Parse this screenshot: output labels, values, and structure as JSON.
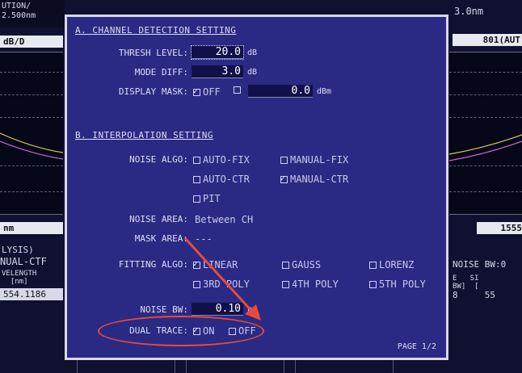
{
  "background": {
    "left_top": "UTION/\n2.500nm",
    "left_unit": "dB/D",
    "left_nm": "nm",
    "left_lysis": "LYSIS)",
    "left_manual": "NUAL-CTF",
    "left_wavelength": "VELENGTH\n[nm]",
    "left_value": "554.1186",
    "right_top": "3.0nm",
    "right_box": "801(AUT",
    "right_nm_box": "1555",
    "right_noise_bw": "NOISE BW:0",
    "right_sub": "E   SI",
    "right_sub2": "BW]  [",
    "right_val": "8     55"
  },
  "dialog": {
    "section_a": {
      "title": "A. CHANNEL DETECTION SETTING",
      "thresh_label": "THRESH LEVEL:",
      "thresh_value": "20.0",
      "thresh_unit": "dB",
      "mode_diff_label": "MODE DIFF:",
      "mode_diff_value": "3.0",
      "mode_diff_unit": "dB",
      "display_mask_label": "DISPLAY MASK:",
      "display_mask_off": "OFF",
      "display_mask_value": "0.0",
      "display_mask_unit": "dBm"
    },
    "section_b": {
      "title": "B. INTERPOLATION SETTING",
      "noise_algo_label": "NOISE ALGO:",
      "noise_algo_options": [
        "AUTO-FIX",
        "MANUAL-FIX",
        "AUTO-CTR",
        "MANUAL-CTR",
        "PIT"
      ],
      "noise_area_label": "NOISE AREA:",
      "noise_area_value": "Between CH",
      "mask_area_label": "MASK AREA:",
      "mask_area_value": "---",
      "fitting_algo_label": "FITTING ALGO:",
      "fitting_options": [
        "LINEAR",
        "GAUSS",
        "LORENZ",
        "3RD POLY",
        "4TH POLY",
        "5TH POLY"
      ],
      "noise_bw_label": "NOISE BW:",
      "noise_bw_value": "0.10",
      "noise_bw_unit": "nm",
      "dual_trace_label": "DUAL TRACE:",
      "dual_trace_on": "ON",
      "dual_trace_off": "OFF"
    },
    "page_indicator": "PAGE 1/2"
  },
  "colors": {
    "dialog_bg": "#2a2a84",
    "annotation": "#e84a3a"
  }
}
